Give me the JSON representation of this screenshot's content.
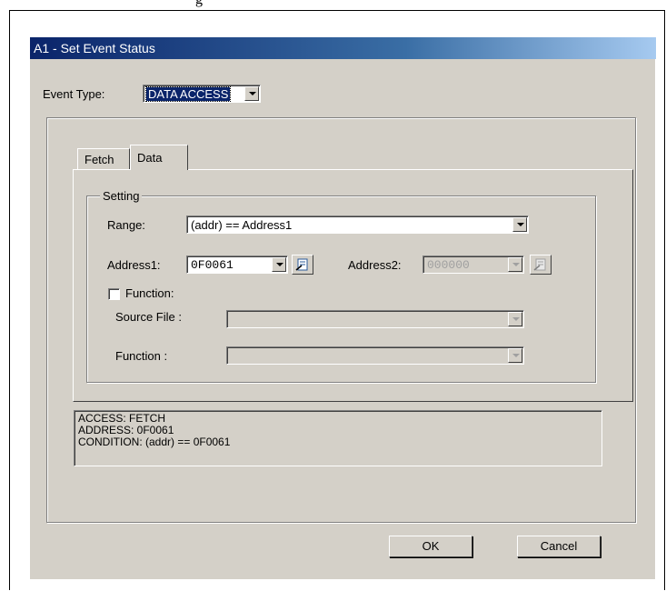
{
  "caption_fragment": "g",
  "dialog": {
    "title": "A1 - Set Event Status",
    "event_type_label": "Event Type:",
    "event_type_value": "DATA ACCESS",
    "tabs": [
      {
        "label": "Fetch"
      },
      {
        "label": "Data"
      }
    ],
    "setting_group": "Setting",
    "range_label": "Range:",
    "range_value": "(addr) == Address1",
    "address1_label": "Address1:",
    "address1_value": "0F0061",
    "address2_label": "Address2:",
    "address2_value": "000000",
    "function_checkbox_label": "Function:",
    "source_file_label": "Source File :",
    "function_label": "Function :",
    "status_lines": [
      "ACCESS: FETCH",
      "ADDRESS: 0F0061",
      "CONDITION: (addr) == 0F0061"
    ],
    "ok_label": "OK",
    "cancel_label": "Cancel"
  }
}
